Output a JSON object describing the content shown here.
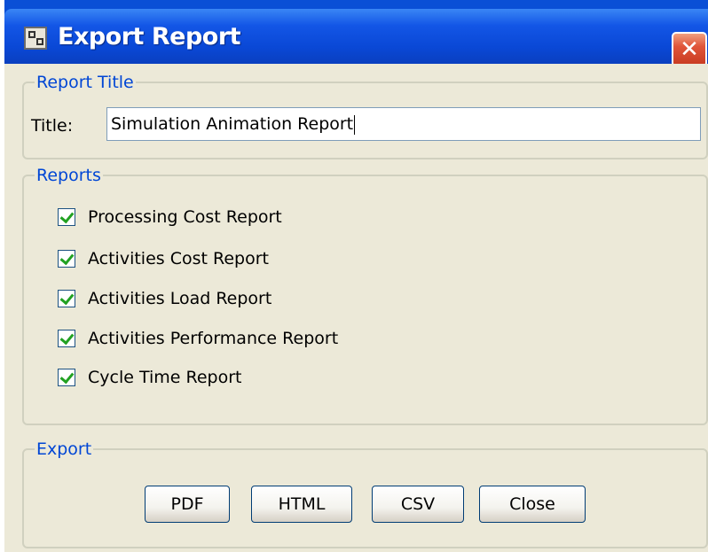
{
  "window": {
    "title": "Export Report",
    "close_glyph": "✕"
  },
  "report_title": {
    "legend": "Report Title",
    "label": "Title:",
    "value": "Simulation Animation Report"
  },
  "reports": {
    "legend": "Reports",
    "items": [
      {
        "label": "Processing Cost Report",
        "checked": true
      },
      {
        "label": "Activities Cost Report",
        "checked": true
      },
      {
        "label": "Activities Load Report",
        "checked": true
      },
      {
        "label": "Activities Performance Report",
        "checked": true
      },
      {
        "label": "Cycle Time Report",
        "checked": true
      }
    ]
  },
  "export": {
    "legend": "Export",
    "buttons": [
      {
        "label": "PDF"
      },
      {
        "label": "HTML"
      },
      {
        "label": "CSV"
      },
      {
        "label": "Close"
      }
    ]
  }
}
